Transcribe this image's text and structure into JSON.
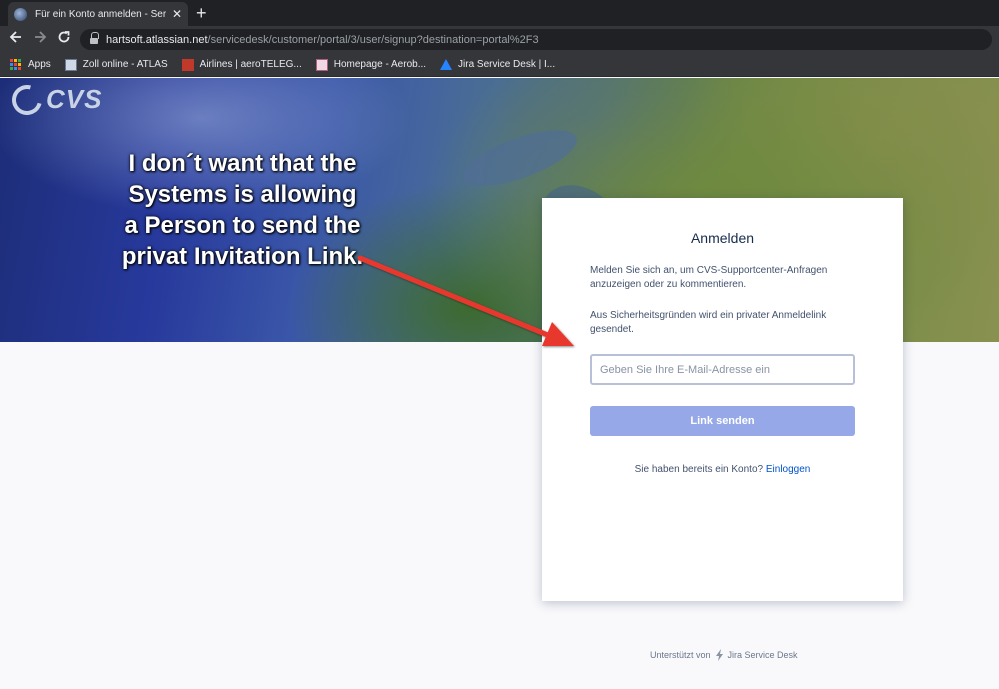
{
  "browser": {
    "tab_title": "Für ein Konto anmelden - Service Desk",
    "tab_close": "✕",
    "new_tab": "+",
    "url_host": "hartsoft.atlassian.net",
    "url_path": "/servicedesk/customer/portal/3/user/signup?destination=portal%2F3",
    "bookmarks": [
      {
        "label": "Apps",
        "icon": "apps-grid-icon"
      },
      {
        "label": "Zoll online - ATLAS",
        "icon": "zoll-favicon"
      },
      {
        "label": "Airlines | aeroTELEG...",
        "icon": "airlines-favicon"
      },
      {
        "label": "Homepage - Aerob...",
        "icon": "homepage-favicon"
      },
      {
        "label": "Jira Service Desk | I...",
        "icon": "jira-favicon"
      }
    ]
  },
  "banner": {
    "logo_text": "CVS",
    "annotation": "I don´t want that the Systems is allowing a Person to send the privat Invitation Link."
  },
  "card": {
    "title": "Anmelden",
    "description": "Melden Sie sich an, um CVS-Supportcenter-Anfragen anzuzeigen oder zu kommentieren.",
    "security_note": "Aus Sicherheitsgründen wird ein privater Anmeldelink gesendet.",
    "email_placeholder": "Geben Sie Ihre E-Mail-Adresse ein",
    "email_value": "",
    "send_button": "Link senden",
    "have_account_text": "Sie haben bereits ein Konto?",
    "login_link": "Einloggen"
  },
  "footer": {
    "powered_by": "Unterstützt von",
    "product": "Jira Service Desk"
  },
  "colors": {
    "button": "#96a8e8",
    "link": "#0052cc",
    "arrow": "#e8392f"
  }
}
